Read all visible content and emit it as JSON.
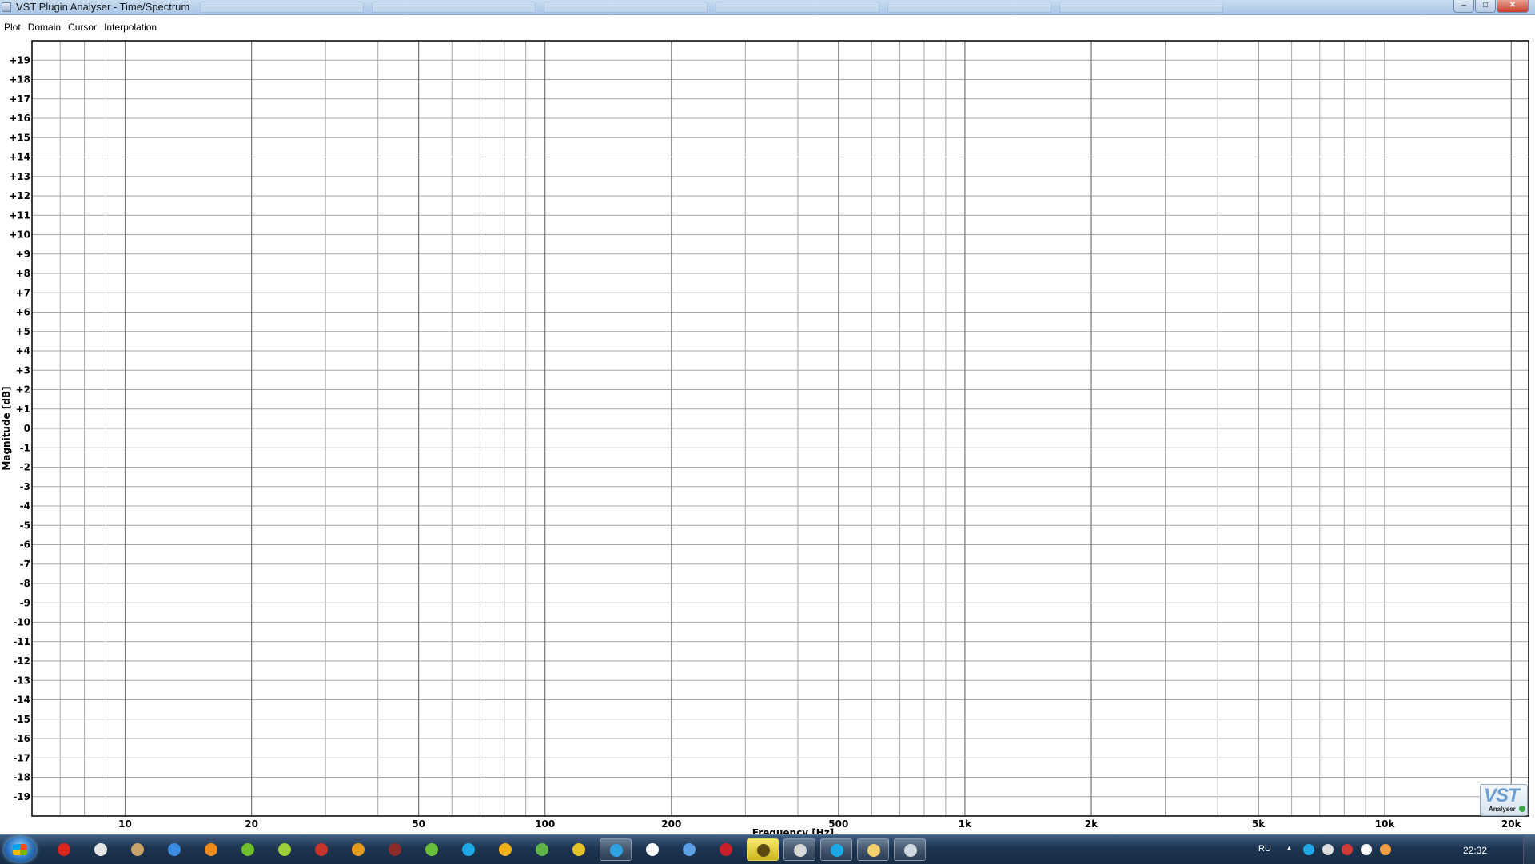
{
  "window": {
    "title": "VST Plugin Analyser - Time/Spectrum",
    "controls": {
      "minimize": "‒",
      "maximize": "□",
      "close": "✕"
    }
  },
  "menu": {
    "items": [
      {
        "id": "plot",
        "label": "Plot"
      },
      {
        "id": "domain",
        "label": "Domain"
      },
      {
        "id": "cursor",
        "label": "Cursor"
      },
      {
        "id": "interpolation",
        "label": "Interpolation"
      }
    ]
  },
  "logo": {
    "big": "VST",
    "small": "Analyser"
  },
  "taskbar": {
    "language": "RU",
    "clock": "22:32",
    "apps": [
      {
        "icon": "red-circle-icon",
        "color": "#d8261c"
      },
      {
        "icon": "hand-icon",
        "color": "#e6e6e6"
      },
      {
        "icon": "photo-icon",
        "color": "#c9a36a"
      },
      {
        "icon": "lightning-icon",
        "color": "#3b8be0"
      },
      {
        "icon": "orange-app-icon",
        "color": "#f08a1c"
      },
      {
        "icon": "green-app-icon",
        "color": "#6fbf2a"
      },
      {
        "icon": "leaf-icon",
        "color": "#9ccf3a"
      },
      {
        "icon": "red-bird-icon",
        "color": "#c6342a"
      },
      {
        "icon": "folder-tools-icon",
        "color": "#e59a1e"
      },
      {
        "icon": "recorder-icon",
        "color": "#8d2a2a"
      },
      {
        "icon": "utorrent-icon",
        "color": "#6abf3a"
      },
      {
        "icon": "skype-icon",
        "color": "#1ea8e6"
      },
      {
        "icon": "warning-icon",
        "color": "#f2b11a"
      },
      {
        "icon": "shield-icon",
        "color": "#5fb548"
      },
      {
        "icon": "chrome-icon",
        "color": "#e2c32a"
      },
      {
        "icon": "telegram-icon",
        "color": "#2fa3e0"
      },
      {
        "icon": "calendar-icon",
        "color": "#ffffff"
      },
      {
        "icon": "bird-icon",
        "color": "#5aa0e6"
      },
      {
        "icon": "game-icon",
        "color": "#c8202a"
      },
      {
        "icon": "clapper-icon",
        "color": "#5a4a10"
      },
      {
        "icon": "speed-icon",
        "color": "#d8d8d8"
      },
      {
        "icon": "skype-2-icon",
        "color": "#1ea8e6"
      },
      {
        "icon": "explorer-icon",
        "color": "#f2d06a"
      },
      {
        "icon": "analyser-icon",
        "color": "#d0d8e0"
      }
    ],
    "tray": [
      {
        "icon": "skype-tray-icon",
        "color": "#1ea8e6"
      },
      {
        "icon": "speed-tray-icon",
        "color": "#dddddd"
      },
      {
        "icon": "network-tray-icon",
        "color": "#d23a3a"
      },
      {
        "icon": "volume-tray-icon",
        "color": "#ffffff"
      },
      {
        "icon": "globe-tray-icon",
        "color": "#f0a040"
      }
    ]
  },
  "chart_data": {
    "type": "line",
    "title": "",
    "xlabel": "Frequency [Hz]",
    "ylabel": "Magnitude [dB]",
    "xscale": "log",
    "xlim": [
      6,
      22000
    ],
    "ylim": [
      -20,
      20
    ],
    "grid": true,
    "series": [],
    "x_tick_values": [
      10,
      20,
      50,
      100,
      200,
      500,
      1000,
      2000,
      5000,
      10000,
      20000
    ],
    "x_tick_labels": [
      "10",
      "20",
      "50",
      "100",
      "200",
      "500",
      "1k",
      "2k",
      "5k",
      "10k",
      "20k"
    ],
    "y_tick_values": [
      19,
      18,
      17,
      16,
      15,
      14,
      13,
      12,
      11,
      10,
      9,
      8,
      7,
      6,
      5,
      4,
      3,
      2,
      1,
      0,
      -1,
      -2,
      -3,
      -4,
      -5,
      -6,
      -7,
      -8,
      -9,
      -10,
      -11,
      -12,
      -13,
      -14,
      -15,
      -16,
      -17,
      -18,
      -19
    ],
    "y_tick_labels": [
      "+19",
      "+18",
      "+17",
      "+16",
      "+15",
      "+14",
      "+13",
      "+12",
      "+11",
      "+10",
      "+9",
      "+8",
      "+7",
      "+6",
      "+5",
      "+4",
      "+3",
      "+2",
      "+1",
      "0",
      "-1",
      "-2",
      "-3",
      "-4",
      "-5",
      "-6",
      "-7",
      "-8",
      "-9",
      "-10",
      "-11",
      "-12",
      "-13",
      "-14",
      "-15",
      "-16",
      "-17",
      "-18",
      "-19"
    ],
    "minor_x_lines": [
      7,
      8,
      9,
      30,
      40,
      60,
      70,
      80,
      90,
      300,
      400,
      600,
      700,
      800,
      900,
      3000,
      4000,
      6000,
      7000,
      8000,
      9000
    ]
  }
}
